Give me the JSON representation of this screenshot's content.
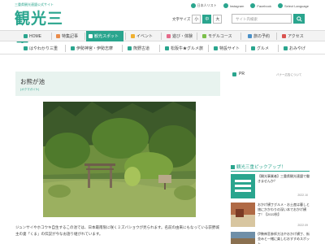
{
  "header": {
    "tagline": "三重県観光連盟公式サイト",
    "logo": "観光三重",
    "top_links": [
      "日本人リスト",
      "Instagram",
      "Facebook",
      "Select Language"
    ],
    "font_size_label": "文字サイズ",
    "font_sizes": [
      "小",
      "中",
      "大"
    ],
    "search_placeholder": "サイト内検索"
  },
  "nav_main": [
    {
      "label": "HOME"
    },
    {
      "label": "特集記事"
    },
    {
      "label": "観光スポット"
    },
    {
      "label": "イベント"
    },
    {
      "label": "遊び・体験"
    },
    {
      "label": "モデルコース"
    },
    {
      "label": "旅の予約"
    },
    {
      "label": "アクセス"
    }
  ],
  "nav_sub": [
    {
      "label": "はやわかり三重"
    },
    {
      "label": "伊勢神宮・伊勢志摩"
    },
    {
      "label": "熊野古道"
    },
    {
      "label": "松阪牛★グルメ旅"
    },
    {
      "label": "特設サイト"
    },
    {
      "label": "グルメ"
    },
    {
      "label": "おみやげ"
    }
  ],
  "article": {
    "title": "お熊が池",
    "title_kana": "(オクマガイケ)",
    "description": "ジュンサイやホコウキ自生するこの池では、日本最南限に咲くミズバショウが見られます。名前の由来にもなっている荻野城主の妻「くま」の伝説が今なお語り継がれています。"
  },
  "sidebar": {
    "pr_label": "PR",
    "pr_link": "バナー広告について",
    "pickup_title": "観光三重ピックアップ！",
    "cards": [
      {
        "text": "【観光事業者】三重県観光連盟で働きませんか？",
        "date": "2022.10"
      },
      {
        "text": "おかげ横丁グルメ・お土産は暮しと旅にかかわりの深い本でおかげ横丁！【2022秋】",
        "date": "2022.09"
      },
      {
        "text": "伊勢神宮参拝方法やおかげ横丁、街並みと一緒に楽しむおすすめスポット",
        "date": ""
      }
    ]
  },
  "colors": {
    "accent": "#2aa58e",
    "title_bg": "#e8f3ef"
  }
}
